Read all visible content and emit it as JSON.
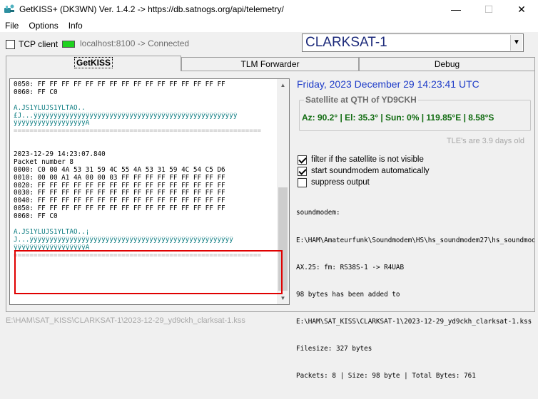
{
  "window": {
    "title": "GetKISS+ (DK3WN) Ver. 1.4.2 -> https://db.satnogs.org/api/telemetry/",
    "minimize": "—",
    "maximize": "☐",
    "close": "✕"
  },
  "menu": {
    "file": "File",
    "options": "Options",
    "info": "Info"
  },
  "toolbar": {
    "tcp_label": "TCP client",
    "tcp_checked": false,
    "connection": "localhost:8100 -> Connected",
    "status_color": "#1ed31e",
    "satellite": "CLARKSAT-1"
  },
  "tabs": [
    "GetKISS",
    "TLM Forwarder",
    "Debug"
  ],
  "log": {
    "lines": [
      {
        "text": "0050: FF FF FF FF FF FF FF FF FF FF FF FF FF FF FF FF",
        "style": ""
      },
      {
        "text": "0060: FF C0",
        "style": ""
      },
      {
        "text": "",
        "style": ""
      },
      {
        "text": "À.JS1YLUJS1YLTÄÖ..",
        "style": "teal"
      },
      {
        "text": "£J...ÿÿÿÿÿÿÿÿÿÿÿÿÿÿÿÿÿÿÿÿÿÿÿÿÿÿÿÿÿÿÿÿÿÿÿÿÿÿÿÿÿÿÿÿÿÿÿÿÿÿÿ",
        "style": "teal"
      },
      {
        "text": "ÿÿÿÿÿÿÿÿÿÿÿÿÿÿÿÿÿÿÀ",
        "style": "teal"
      },
      {
        "text": "==============================================================",
        "style": "dim"
      },
      {
        "text": "",
        "style": ""
      },
      {
        "text": "",
        "style": ""
      },
      {
        "text": "2023-12-29 14:23:07.840",
        "style": ""
      },
      {
        "text": "Packet number 8",
        "style": ""
      },
      {
        "text": "0000: C0 00 4A 53 31 59 4C 55 4A 53 31 59 4C 54 C5 D6",
        "style": ""
      },
      {
        "text": "0010: 00 00 A1 4A 00 00 03 FF FF FF FF FF FF FF FF FF",
        "style": ""
      },
      {
        "text": "0020: FF FF FF FF FF FF FF FF FF FF FF FF FF FF FF FF",
        "style": ""
      },
      {
        "text": "0030: FF FF FF FF FF FF FF FF FF FF FF FF FF FF FF FF",
        "style": ""
      },
      {
        "text": "0040: FF FF FF FF FF FF FF FF FF FF FF FF FF FF FF FF",
        "style": ""
      },
      {
        "text": "0050: FF FF FF FF FF FF FF FF FF FF FF FF FF FF FF FF",
        "style": ""
      },
      {
        "text": "0060: FF C0",
        "style": ""
      },
      {
        "text": "",
        "style": ""
      },
      {
        "text": "À.JS1YLUJS1YLTÅÖ..¡",
        "style": "teal"
      },
      {
        "text": "J...ÿÿÿÿÿÿÿÿÿÿÿÿÿÿÿÿÿÿÿÿÿÿÿÿÿÿÿÿÿÿÿÿÿÿÿÿÿÿÿÿÿÿÿÿÿÿÿÿÿÿÿ",
        "style": "teal"
      },
      {
        "text": "ÿÿÿÿÿÿÿÿÿÿÿÿÿÿÿÿÿÿÀ",
        "style": "teal"
      },
      {
        "text": "==============================================================",
        "style": "dim"
      }
    ]
  },
  "info": {
    "datetime": "Friday, 2023 December 29  14:23:41 UTC",
    "qth_title": "Satellite at QTH of YD9CKH",
    "qth_values": "Az: 90.2° | El: 35.3° | Sun: 0% | 119.85°E | 8.58°S",
    "tle_age": "TLE's are 3.9 days old"
  },
  "options": {
    "filter": {
      "label": "filter if the satellite is not visible",
      "checked": true
    },
    "autostart": {
      "label": "start soundmodem automatically",
      "checked": true
    },
    "suppress": {
      "label": "suppress output",
      "checked": false
    }
  },
  "soundmodem": {
    "lines": [
      "soundmodem:",
      "E:\\HAM\\Amateurfunk\\Soundmodem\\HS\\hs_soundmodem27\\hs_soundmodem",
      "AX.25: fm: RS38S-1 -> R4UAB",
      "98 bytes has been added to",
      "E:\\HAM\\SAT_KISS\\CLARKSAT-1\\2023-12-29_yd9ckh_clarksat-1.kss",
      "Filesize: 327 bytes",
      "Packets: 8 | Size: 98 byte | Total Bytes: 761"
    ]
  },
  "status": {
    "path": "E:\\HAM\\SAT_KISS\\CLARKSAT-1\\2023-12-29_yd9ckh_clarksat-1.kss"
  }
}
